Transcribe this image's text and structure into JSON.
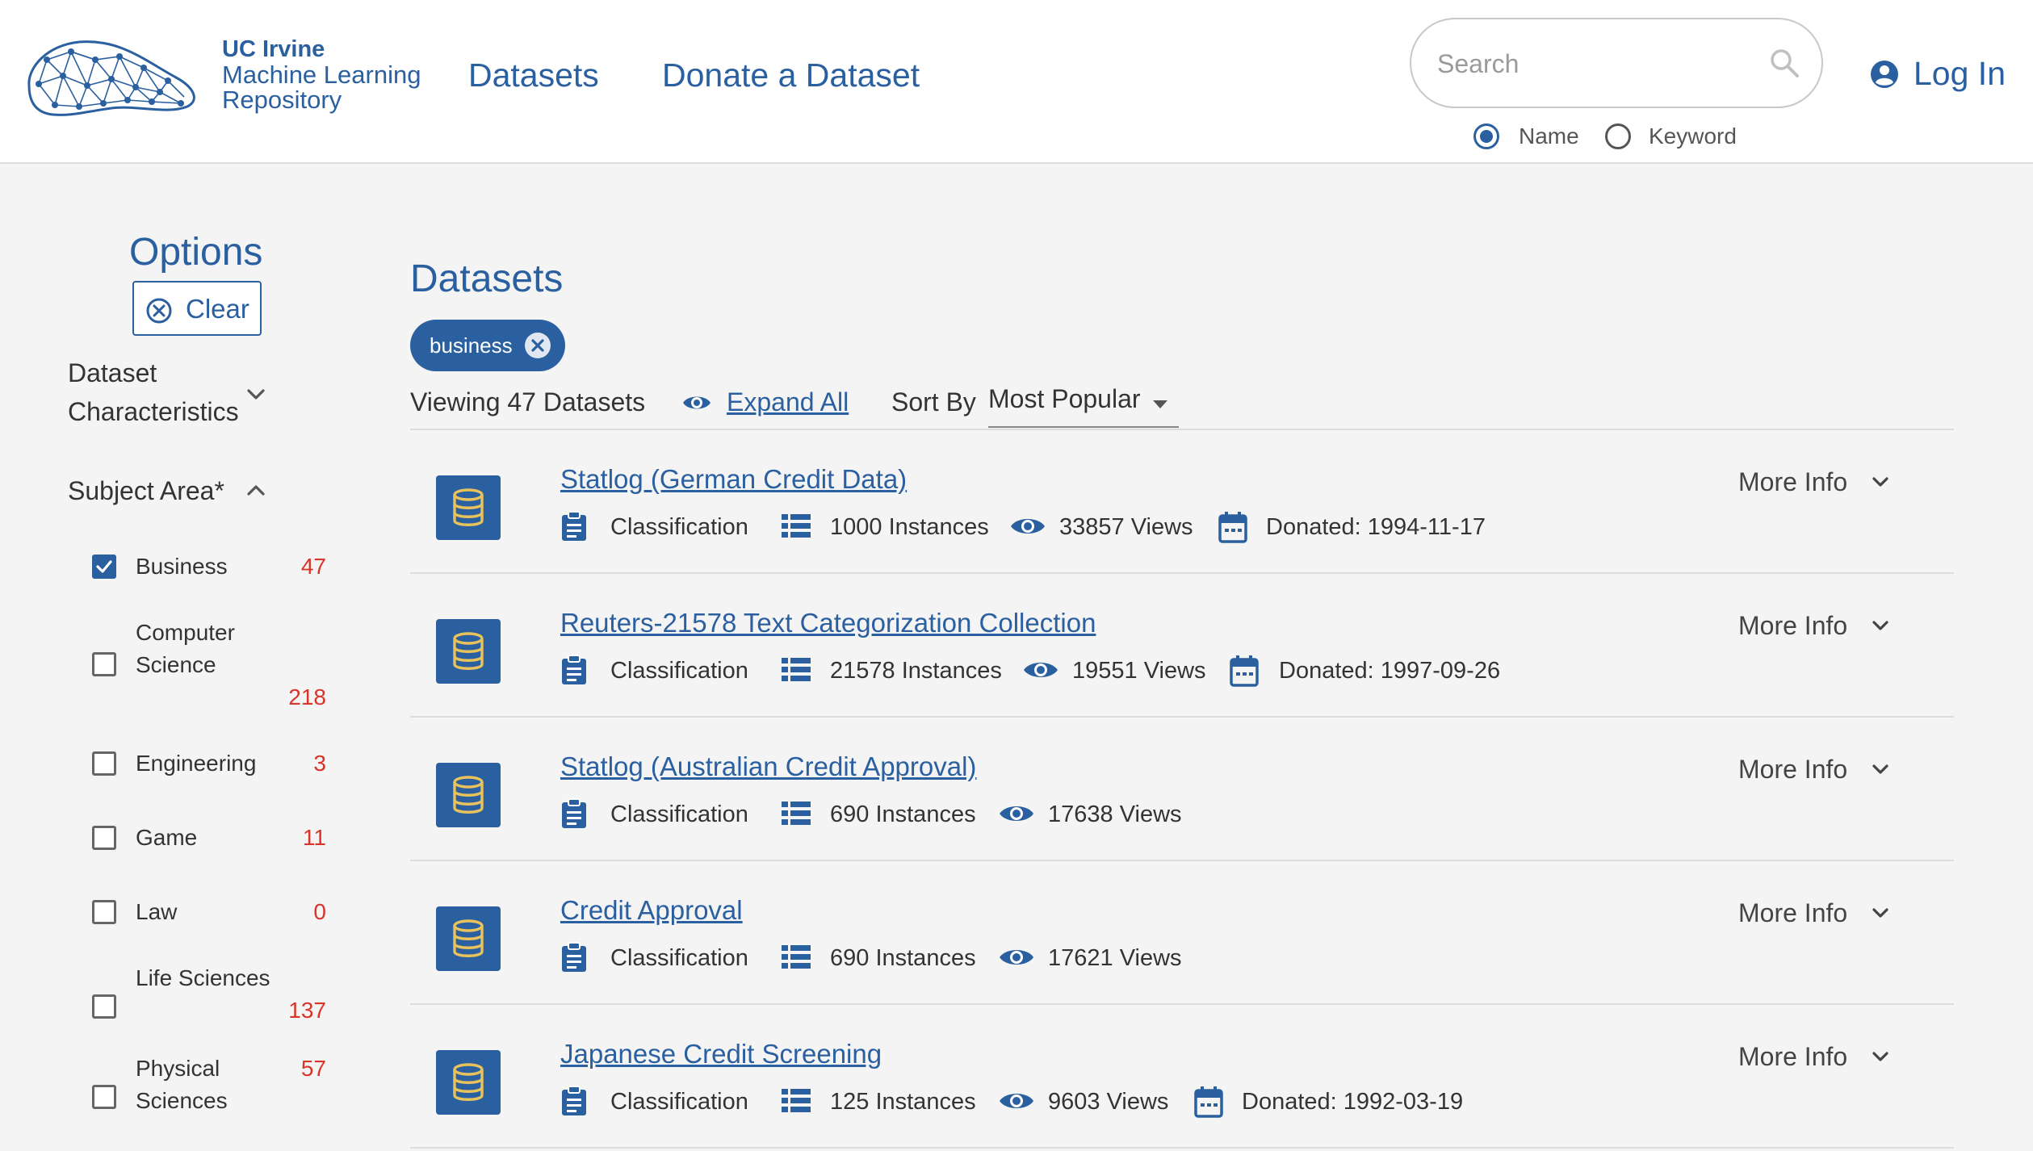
{
  "header": {
    "logo": {
      "line1": "UC Irvine",
      "line2": "Machine Learning",
      "line3": "Repository"
    },
    "nav": [
      {
        "label": "Datasets"
      },
      {
        "label": "Donate a Dataset"
      }
    ],
    "search": {
      "placeholder": "Search",
      "value": ""
    },
    "search_mode": [
      {
        "label": "Name",
        "checked": true
      },
      {
        "label": "Keyword",
        "checked": false
      }
    ],
    "login_label": "Log In",
    "accent_color": "#2a5fa0"
  },
  "sidebar": {
    "title": "Options",
    "clear_label": "Clear",
    "dataset_characteristics": "Dataset Characteristics",
    "dc_line1": "Dataset",
    "dc_line2": "Characteristics",
    "subject_area": "Subject Area*",
    "subjects": [
      {
        "line1": "Business",
        "line2": "",
        "count": "47",
        "checked": true
      },
      {
        "line1": "Computer",
        "line2": "Science",
        "count": "218",
        "checked": false
      },
      {
        "line1": "Engineering",
        "line2": "",
        "count": "3",
        "checked": false
      },
      {
        "line1": "Game",
        "line2": "",
        "count": "11",
        "checked": false
      },
      {
        "line1": "Law",
        "line2": "",
        "count": "0",
        "checked": false
      },
      {
        "line1": "Life Sciences",
        "line2": "",
        "count": "137",
        "checked": false
      },
      {
        "line1": "Physical",
        "line2": "Sciences",
        "count": "57",
        "checked": false
      }
    ]
  },
  "main": {
    "title": "Datasets",
    "filter_chip": "business",
    "viewing": "Viewing 47 Datasets",
    "expand_all": "Expand All",
    "sort_by": "Sort By",
    "sort_value": "Most Popular",
    "more_info": "More Info",
    "datasets": [
      {
        "title": "Statlog (German Credit Data)",
        "task": "Classification",
        "instances": "1000 Instances",
        "views": "33857 Views",
        "donated": "Donated: 1994-11-17"
      },
      {
        "title": "Reuters-21578 Text Categorization Collection",
        "task": "Classification",
        "instances": "21578 Instances",
        "views": "19551 Views",
        "donated": "Donated: 1997-09-26"
      },
      {
        "title": "Statlog (Australian Credit Approval)",
        "task": "Classification",
        "instances": "690 Instances",
        "views": "17638 Views",
        "donated": ""
      },
      {
        "title": "Credit Approval",
        "task": "Classification",
        "instances": "690 Instances",
        "views": "17621 Views",
        "donated": ""
      },
      {
        "title": "Japanese Credit Screening",
        "task": "Classification",
        "instances": "125 Instances",
        "views": "9603 Views",
        "donated": "Donated: 1992-03-19"
      }
    ]
  }
}
